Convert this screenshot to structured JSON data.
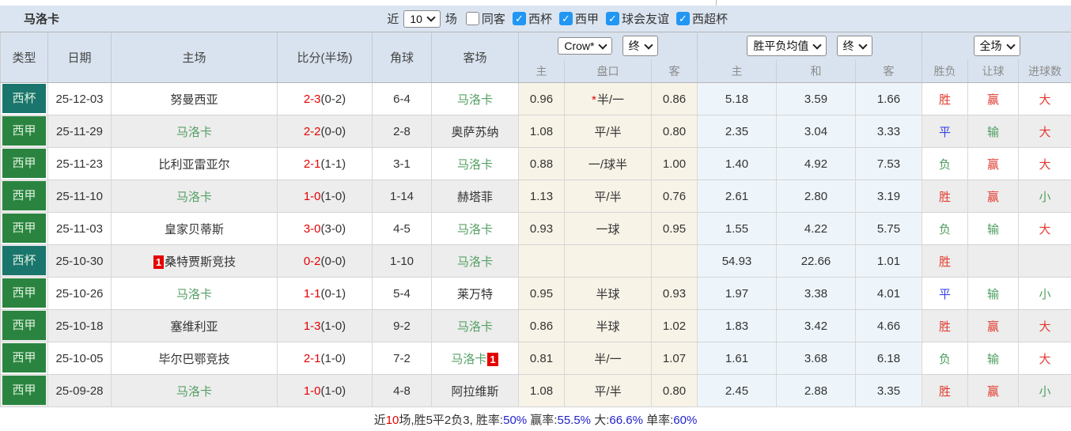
{
  "colors": {
    "cup_badge": "#1a756d",
    "league_badge": "#2a8440",
    "score_red": "#e50000",
    "team_green": "#55a065",
    "result_red": "#e23b30",
    "result_green": "#4d9e5f",
    "result_blue": "#3a45e6",
    "summary_blue": "#2222cc",
    "checkbox_blue": "#2196f3",
    "bar_background": "#dbe5f1"
  },
  "top_bar": {
    "title": "马洛卡",
    "recent_label": "近",
    "recent_select_value": "10",
    "matches_label": "场",
    "same_opponent": {
      "label": "同客",
      "checked": false
    },
    "leagues": [
      {
        "label": "西杯",
        "checked": true
      },
      {
        "label": "西甲",
        "checked": true
      },
      {
        "label": "球会友谊",
        "checked": true
      },
      {
        "label": "西超杯",
        "checked": true
      }
    ]
  },
  "table": {
    "headers": {
      "type": "类型",
      "date": "日期",
      "home": "主场",
      "score": "比分(半场)",
      "corners": "角球",
      "away": "客场",
      "asian_select": "Crow*",
      "asian_time_select": "终",
      "euro_select": "胜平负均值",
      "euro_time_select": "终",
      "scope_select": "全场",
      "sub": [
        "主",
        "盘口",
        "客",
        "主",
        "和",
        "客",
        "胜负",
        "让球",
        "进球数"
      ]
    },
    "rows": [
      {
        "type": "西杯",
        "type_color": "cup",
        "date": "25-12-03",
        "home": {
          "name": "努曼西亚",
          "self": false
        },
        "score": {
          "full": "2-3",
          "half": "(0-2)"
        },
        "corners": "6-4",
        "away": {
          "name": "马洛卡",
          "self": true
        },
        "asian": {
          "home": "0.96",
          "star": true,
          "line": "半/一",
          "away": "0.86"
        },
        "euro": {
          "home": "5.18",
          "draw": "3.59",
          "away": "1.66"
        },
        "results": {
          "outcome": {
            "text": "胜",
            "color": "red"
          },
          "handicap": {
            "text": "赢",
            "color": "red"
          },
          "goals": {
            "text": "大",
            "color": "red"
          }
        }
      },
      {
        "type": "西甲",
        "type_color": "league",
        "date": "25-11-29",
        "home": {
          "name": "马洛卡",
          "self": true
        },
        "score": {
          "full": "2-2",
          "half": "(0-0)"
        },
        "corners": "2-8",
        "away": {
          "name": "奥萨苏纳",
          "self": false
        },
        "asian": {
          "home": "1.08",
          "star": false,
          "line": "平/半",
          "away": "0.80"
        },
        "euro": {
          "home": "2.35",
          "draw": "3.04",
          "away": "3.33"
        },
        "results": {
          "outcome": {
            "text": "平",
            "color": "blue"
          },
          "handicap": {
            "text": "输",
            "color": "green"
          },
          "goals": {
            "text": "大",
            "color": "red"
          }
        }
      },
      {
        "type": "西甲",
        "type_color": "league",
        "date": "25-11-23",
        "home": {
          "name": "比利亚雷亚尔",
          "self": false
        },
        "score": {
          "full": "2-1",
          "half": "(1-1)"
        },
        "corners": "3-1",
        "away": {
          "name": "马洛卡",
          "self": true
        },
        "asian": {
          "home": "0.88",
          "star": false,
          "line": "一/球半",
          "away": "1.00"
        },
        "euro": {
          "home": "1.40",
          "draw": "4.92",
          "away": "7.53"
        },
        "results": {
          "outcome": {
            "text": "负",
            "color": "green"
          },
          "handicap": {
            "text": "赢",
            "color": "red"
          },
          "goals": {
            "text": "大",
            "color": "red"
          }
        }
      },
      {
        "type": "西甲",
        "type_color": "league",
        "date": "25-11-10",
        "home": {
          "name": "马洛卡",
          "self": true
        },
        "score": {
          "full": "1-0",
          "half": "(1-0)"
        },
        "corners": "1-14",
        "away": {
          "name": "赫塔菲",
          "self": false
        },
        "asian": {
          "home": "1.13",
          "star": false,
          "line": "平/半",
          "away": "0.76"
        },
        "euro": {
          "home": "2.61",
          "draw": "2.80",
          "away": "3.19"
        },
        "results": {
          "outcome": {
            "text": "胜",
            "color": "red"
          },
          "handicap": {
            "text": "赢",
            "color": "red"
          },
          "goals": {
            "text": "小",
            "color": "green"
          }
        }
      },
      {
        "type": "西甲",
        "type_color": "league",
        "date": "25-11-03",
        "home": {
          "name": "皇家贝蒂斯",
          "self": false
        },
        "score": {
          "full": "3-0",
          "half": "(3-0)"
        },
        "corners": "4-5",
        "away": {
          "name": "马洛卡",
          "self": true
        },
        "asian": {
          "home": "0.93",
          "star": false,
          "line": "一球",
          "away": "0.95"
        },
        "euro": {
          "home": "1.55",
          "draw": "4.22",
          "away": "5.75"
        },
        "results": {
          "outcome": {
            "text": "负",
            "color": "green"
          },
          "handicap": {
            "text": "输",
            "color": "green"
          },
          "goals": {
            "text": "大",
            "color": "red"
          }
        }
      },
      {
        "type": "西杯",
        "type_color": "cup",
        "date": "25-10-30",
        "home": {
          "name": "桑特贾斯竞技",
          "self": false,
          "badge": "1",
          "badge_pos": "before"
        },
        "score": {
          "full": "0-2",
          "half": "(0-0)"
        },
        "corners": "1-10",
        "away": {
          "name": "马洛卡",
          "self": true
        },
        "asian": {
          "home": "",
          "star": false,
          "line": "",
          "away": ""
        },
        "euro": {
          "home": "54.93",
          "draw": "22.66",
          "away": "1.01"
        },
        "results": {
          "outcome": {
            "text": "胜",
            "color": "red"
          },
          "handicap": {
            "text": "",
            "color": "red"
          },
          "goals": {
            "text": "",
            "color": "red"
          }
        }
      },
      {
        "type": "西甲",
        "type_color": "league",
        "date": "25-10-26",
        "home": {
          "name": "马洛卡",
          "self": true
        },
        "score": {
          "full": "1-1",
          "half": "(0-1)"
        },
        "corners": "5-4",
        "away": {
          "name": "莱万特",
          "self": false
        },
        "asian": {
          "home": "0.95",
          "star": false,
          "line": "半球",
          "away": "0.93"
        },
        "euro": {
          "home": "1.97",
          "draw": "3.38",
          "away": "4.01"
        },
        "results": {
          "outcome": {
            "text": "平",
            "color": "blue"
          },
          "handicap": {
            "text": "输",
            "color": "green"
          },
          "goals": {
            "text": "小",
            "color": "green"
          }
        }
      },
      {
        "type": "西甲",
        "type_color": "league",
        "date": "25-10-18",
        "home": {
          "name": "塞维利亚",
          "self": false
        },
        "score": {
          "full": "1-3",
          "half": "(1-0)"
        },
        "corners": "9-2",
        "away": {
          "name": "马洛卡",
          "self": true
        },
        "asian": {
          "home": "0.86",
          "star": false,
          "line": "半球",
          "away": "1.02"
        },
        "euro": {
          "home": "1.83",
          "draw": "3.42",
          "away": "4.66"
        },
        "results": {
          "outcome": {
            "text": "胜",
            "color": "red"
          },
          "handicap": {
            "text": "赢",
            "color": "red"
          },
          "goals": {
            "text": "大",
            "color": "red"
          }
        }
      },
      {
        "type": "西甲",
        "type_color": "league",
        "date": "25-10-05",
        "home": {
          "name": "毕尔巴鄂竞技",
          "self": false
        },
        "score": {
          "full": "2-1",
          "half": "(1-0)"
        },
        "corners": "7-2",
        "away": {
          "name": "马洛卡",
          "self": true,
          "badge": "1",
          "badge_pos": "after"
        },
        "asian": {
          "home": "0.81",
          "star": false,
          "line": "半/一",
          "away": "1.07"
        },
        "euro": {
          "home": "1.61",
          "draw": "3.68",
          "away": "6.18"
        },
        "results": {
          "outcome": {
            "text": "负",
            "color": "green"
          },
          "handicap": {
            "text": "输",
            "color": "green"
          },
          "goals": {
            "text": "大",
            "color": "red"
          }
        }
      },
      {
        "type": "西甲",
        "type_color": "league",
        "date": "25-09-28",
        "home": {
          "name": "马洛卡",
          "self": true
        },
        "score": {
          "full": "1-0",
          "half": "(1-0)"
        },
        "corners": "4-8",
        "away": {
          "name": "阿拉维斯",
          "self": false
        },
        "asian": {
          "home": "1.08",
          "star": false,
          "line": "平/半",
          "away": "0.80"
        },
        "euro": {
          "home": "2.45",
          "draw": "2.88",
          "away": "3.35"
        },
        "results": {
          "outcome": {
            "text": "胜",
            "color": "red"
          },
          "handicap": {
            "text": "赢",
            "color": "red"
          },
          "goals": {
            "text": "小",
            "color": "green"
          }
        }
      }
    ]
  },
  "footer": {
    "parts": [
      {
        "text": "近",
        "c": "dark"
      },
      {
        "text": "10",
        "c": "red"
      },
      {
        "text": "场,胜5平2负3, 胜率:",
        "c": "dark"
      },
      {
        "text": "50%",
        "c": "blue"
      },
      {
        "text": " 赢率:",
        "c": "dark"
      },
      {
        "text": "55.5%",
        "c": "blue"
      },
      {
        "text": " 大:",
        "c": "dark"
      },
      {
        "text": "66.6%",
        "c": "blue"
      },
      {
        "text": " 单率:",
        "c": "dark"
      },
      {
        "text": "60%",
        "c": "blue"
      }
    ]
  }
}
